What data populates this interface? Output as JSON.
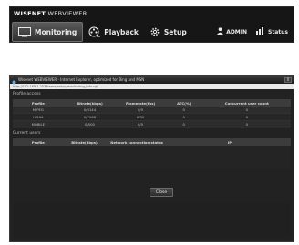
{
  "app": {
    "logo_brand": "WISENET",
    "logo_product": "WEBVIEWER",
    "nav": {
      "monitoring": "Monitoring",
      "playback": "Playback",
      "setup": "Setup",
      "user": "ADMIN",
      "status": "Status"
    },
    "icons": [
      "monitor-icon",
      "film-reel-icon",
      "gear-icon",
      "user-icon",
      "status-icon"
    ]
  },
  "popup": {
    "title": "Wisenet WEBVIEWER - Internet Explorer, optimized for Bing and MSN",
    "address": "http://192.168.1.253/home/setup/monitoring_info.cgi",
    "close_x": "X",
    "profile_section": "Profile access",
    "profile_columns": [
      "Profile",
      "Bitrate(kbps)",
      "Framerate(fps)",
      "ATC(%)",
      "Concurrent user count"
    ],
    "profile_rows": [
      [
        "MJPEG",
        "0/6144",
        "0/5",
        "0",
        "0"
      ],
      [
        "H.264",
        "0/7168",
        "0/30",
        "0",
        "0"
      ],
      [
        "MOBILE",
        "0/500",
        "0/5",
        "0",
        "0"
      ]
    ],
    "users_section": "Current users",
    "users_columns": [
      "Profile",
      "Bitrate(kbps)",
      "Network connection status",
      "IP"
    ],
    "close_button": "Close"
  },
  "colors": {
    "header_bg": "#161616",
    "popup_bg": "#222222",
    "row_odd": "#2c2c2c",
    "row_even": "#262626"
  }
}
